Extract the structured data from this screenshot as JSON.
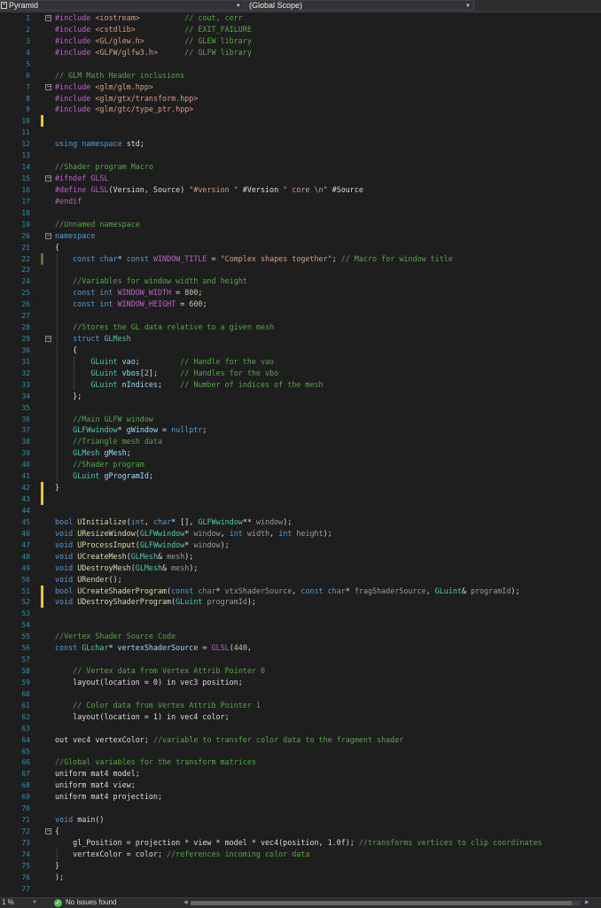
{
  "toolbar": {
    "project_label": "Pyramid",
    "scope_label": "(Global Scope)"
  },
  "editor": {
    "lines": [
      [
        [
          "m",
          "#include "
        ],
        [
          "s",
          "<iostream>"
        ],
        [
          "",
          "          "
        ],
        [
          "c",
          "// cout, cerr"
        ]
      ],
      [
        [
          "m",
          "#include "
        ],
        [
          "s",
          "<cstdlib>"
        ],
        [
          "",
          "           "
        ],
        [
          "c",
          "// EXIT_FAILURE"
        ]
      ],
      [
        [
          "m",
          "#include "
        ],
        [
          "s",
          "<GL/glew.h>"
        ],
        [
          "",
          "         "
        ],
        [
          "c",
          "// GLEW library"
        ]
      ],
      [
        [
          "m",
          "#include "
        ],
        [
          "s",
          "<GLFW/glfw3.h>"
        ],
        [
          "",
          "      "
        ],
        [
          "c",
          "// GLFW library"
        ]
      ],
      [],
      [
        [
          "c",
          "// GLM Math Header inclusions"
        ]
      ],
      [
        [
          "m",
          "#include "
        ],
        [
          "s",
          "<glm/glm.hpp>"
        ]
      ],
      [
        [
          "m",
          "#include "
        ],
        [
          "s",
          "<glm/gtx/transform.hpp>"
        ]
      ],
      [
        [
          "m",
          "#include "
        ],
        [
          "s",
          "<glm/gtc/type_ptr.hpp>"
        ]
      ],
      [],
      [],
      [
        [
          "k",
          "using namespace "
        ],
        [
          "",
          "std;"
        ]
      ],
      [],
      [
        [
          "c",
          "//Shader program Macro"
        ]
      ],
      [
        [
          "m",
          "#ifndef "
        ],
        [
          "m",
          "GLSL"
        ]
      ],
      [
        [
          "m",
          "#define "
        ],
        [
          "m",
          "GLSL"
        ],
        [
          "",
          "(Version, Source) "
        ],
        [
          "s",
          "\"#version \""
        ],
        [
          "",
          " #Version "
        ],
        [
          "s",
          "\" core \\n\""
        ],
        [
          "",
          " #Source"
        ]
      ],
      [
        [
          "m",
          "#endif"
        ]
      ],
      [],
      [
        [
          "c",
          "//Unnamed namespace"
        ]
      ],
      [
        [
          "k",
          "namespace"
        ]
      ],
      [
        [
          "",
          "{"
        ]
      ],
      [
        [
          "",
          "    "
        ],
        [
          "k",
          "const char"
        ],
        [
          "",
          "* "
        ],
        [
          "k",
          "const "
        ],
        [
          "m",
          "WINDOW_TITLE"
        ],
        [
          "",
          " = "
        ],
        [
          "s",
          "\"Complex shapes together\""
        ],
        [
          "",
          "; "
        ],
        [
          "c",
          "// Macro for window title"
        ]
      ],
      [],
      [
        [
          "",
          "    "
        ],
        [
          "c",
          "//Variables for window width and height"
        ]
      ],
      [
        [
          "",
          "    "
        ],
        [
          "k",
          "const int "
        ],
        [
          "m",
          "WINDOW_WIDTH"
        ],
        [
          "",
          " = "
        ],
        [
          "n",
          "800"
        ],
        [
          "",
          ";"
        ]
      ],
      [
        [
          "",
          "    "
        ],
        [
          "k",
          "const int "
        ],
        [
          "m",
          "WINDOW_HEIGHT"
        ],
        [
          "",
          " = "
        ],
        [
          "n",
          "600"
        ],
        [
          "",
          ";"
        ]
      ],
      [],
      [
        [
          "",
          "    "
        ],
        [
          "c",
          "//Stores the GL data relative to a given mesh"
        ]
      ],
      [
        [
          "",
          "    "
        ],
        [
          "k",
          "struct "
        ],
        [
          "t",
          "GLMesh"
        ]
      ],
      [
        [
          "",
          "    {"
        ]
      ],
      [
        [
          "",
          "        "
        ],
        [
          "t",
          "GLuint "
        ],
        [
          "v",
          "vao"
        ],
        [
          "",
          ";         "
        ],
        [
          "c",
          "// Handle for the vao"
        ]
      ],
      [
        [
          "",
          "        "
        ],
        [
          "t",
          "GLuint "
        ],
        [
          "v",
          "vbos"
        ],
        [
          "",
          "["
        ],
        [
          "n",
          "2"
        ],
        [
          "",
          "];     "
        ],
        [
          "c",
          "// Handles for the vbo"
        ]
      ],
      [
        [
          "",
          "        "
        ],
        [
          "t",
          "GLuint "
        ],
        [
          "v",
          "nIndices"
        ],
        [
          "",
          ";    "
        ],
        [
          "c",
          "// Number of indices of the mesh"
        ]
      ],
      [
        [
          "",
          "    };"
        ]
      ],
      [],
      [
        [
          "",
          "    "
        ],
        [
          "c",
          "//Main GLFW window"
        ]
      ],
      [
        [
          "",
          "    "
        ],
        [
          "t",
          "GLFWwindow"
        ],
        [
          "",
          "* "
        ],
        [
          "v",
          "gWindow"
        ],
        [
          "",
          " = "
        ],
        [
          "k",
          "nullptr"
        ],
        [
          "",
          ";"
        ]
      ],
      [
        [
          "",
          "    "
        ],
        [
          "c",
          "//Triangle mesh data"
        ]
      ],
      [
        [
          "",
          "    "
        ],
        [
          "t",
          "GLMesh "
        ],
        [
          "v",
          "gMesh"
        ],
        [
          "",
          ";"
        ]
      ],
      [
        [
          "",
          "    "
        ],
        [
          "c",
          "//Shader program"
        ]
      ],
      [
        [
          "",
          "    "
        ],
        [
          "t",
          "GLuint "
        ],
        [
          "v",
          "gProgramId"
        ],
        [
          "",
          ";"
        ]
      ],
      [
        [
          "",
          "}"
        ]
      ],
      [],
      [],
      [
        [
          "k",
          "bool "
        ],
        [
          "f",
          "UInitialize"
        ],
        [
          "",
          "("
        ],
        [
          "k",
          "int"
        ],
        [
          "",
          ", "
        ],
        [
          "k",
          "char"
        ],
        [
          "",
          "* [], "
        ],
        [
          "t",
          "GLFWwindow"
        ],
        [
          "",
          "** "
        ],
        [
          "p",
          "window"
        ],
        [
          "",
          ");"
        ]
      ],
      [
        [
          "k",
          "void "
        ],
        [
          "f",
          "UResizeWindow"
        ],
        [
          "",
          "("
        ],
        [
          "t",
          "GLFWwindow"
        ],
        [
          "",
          "* "
        ],
        [
          "p",
          "window"
        ],
        [
          "",
          ", "
        ],
        [
          "k",
          "int "
        ],
        [
          "p",
          "width"
        ],
        [
          "",
          ", "
        ],
        [
          "k",
          "int "
        ],
        [
          "p",
          "height"
        ],
        [
          "",
          ");"
        ]
      ],
      [
        [
          "k",
          "void "
        ],
        [
          "f",
          "UProcessInput"
        ],
        [
          "",
          "("
        ],
        [
          "t",
          "GLFWwindow"
        ],
        [
          "",
          "* "
        ],
        [
          "p",
          "window"
        ],
        [
          "",
          ");"
        ]
      ],
      [
        [
          "k",
          "void "
        ],
        [
          "f",
          "UCreateMesh"
        ],
        [
          "",
          "("
        ],
        [
          "t",
          "GLMesh"
        ],
        [
          "",
          "& "
        ],
        [
          "p",
          "mesh"
        ],
        [
          "",
          ");"
        ]
      ],
      [
        [
          "k",
          "void "
        ],
        [
          "f",
          "UDestroyMesh"
        ],
        [
          "",
          "("
        ],
        [
          "t",
          "GLMesh"
        ],
        [
          "",
          "& "
        ],
        [
          "p",
          "mesh"
        ],
        [
          "",
          ");"
        ]
      ],
      [
        [
          "k",
          "void "
        ],
        [
          "f",
          "URender"
        ],
        [
          "",
          "();"
        ]
      ],
      [
        [
          "k",
          "bool "
        ],
        [
          "f",
          "UCreateShaderProgram"
        ],
        [
          "",
          "("
        ],
        [
          "k",
          "const char"
        ],
        [
          "",
          "* "
        ],
        [
          "p",
          "vtxShaderSource"
        ],
        [
          "",
          ", "
        ],
        [
          "k",
          "const char"
        ],
        [
          "",
          "* "
        ],
        [
          "p",
          "fragShaderSource"
        ],
        [
          "",
          ", "
        ],
        [
          "t",
          "GLuint"
        ],
        [
          "",
          "& "
        ],
        [
          "p",
          "programId"
        ],
        [
          "",
          ");"
        ]
      ],
      [
        [
          "k",
          "void "
        ],
        [
          "f",
          "UDestroyShaderProgram"
        ],
        [
          "",
          "("
        ],
        [
          "t",
          "GLuint "
        ],
        [
          "p",
          "programId"
        ],
        [
          "",
          ");"
        ]
      ],
      [],
      [],
      [
        [
          "c",
          "//Vertex Shader Source Code"
        ]
      ],
      [
        [
          "k",
          "const "
        ],
        [
          "t",
          "GLchar"
        ],
        [
          "",
          "* "
        ],
        [
          "v",
          "vertexShaderSource"
        ],
        [
          "",
          " = "
        ],
        [
          "m",
          "GLSL"
        ],
        [
          "",
          "("
        ],
        [
          "n",
          "440"
        ],
        [
          "",
          ","
        ]
      ],
      [],
      [
        [
          "",
          "    "
        ],
        [
          "c",
          "// Vertex data from Vertex Attrib Pointer 0"
        ]
      ],
      [
        [
          "",
          "    layout(location = 0) in vec3 position;"
        ]
      ],
      [],
      [
        [
          "",
          "    "
        ],
        [
          "c",
          "// Color data from Vertex Attrib Pointer 1"
        ]
      ],
      [
        [
          "",
          "    layout(location = 1) in vec4 color;"
        ]
      ],
      [],
      [
        [
          "",
          "out vec4 vertexColor; "
        ],
        [
          "c",
          "//variable to transfer color data to the fragment shader"
        ]
      ],
      [],
      [
        [
          "c",
          "//Global variables for the transform matrices"
        ]
      ],
      [
        [
          "",
          "uniform mat4 model;"
        ]
      ],
      [
        [
          "",
          "uniform mat4 view;"
        ]
      ],
      [
        [
          "",
          "uniform mat4 projection;"
        ]
      ],
      [],
      [
        [
          "k",
          "void "
        ],
        [
          "",
          "main()"
        ]
      ],
      [
        [
          "",
          "{"
        ]
      ],
      [
        [
          "",
          "    gl_Position = projection * view * model * vec4(position, 1.0f); "
        ],
        [
          "c",
          "//transforms vertices to clip coordinates"
        ]
      ],
      [
        [
          "",
          "    vertexColor = color; "
        ],
        [
          "c",
          "//references incoming color data"
        ]
      ],
      [
        [
          "",
          "}"
        ]
      ],
      [
        [
          "",
          ");"
        ]
      ],
      [],
      []
    ]
  },
  "status": {
    "zoom": "1 %",
    "issues": "No issues found"
  },
  "colors": {
    "background": "#1e1e1e",
    "line_numbers": "#2b91af",
    "comment": "#57a64a",
    "string": "#d69d85",
    "keyword": "#569cd6",
    "macro": "#bd63c5",
    "type": "#4ec9b0",
    "function": "#dcdcaa"
  }
}
